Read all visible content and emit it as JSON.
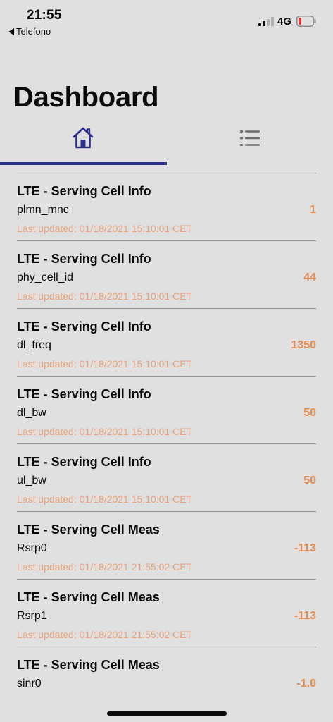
{
  "status_bar": {
    "time": "21:55",
    "back_label": "Telefono",
    "network": "4G",
    "signal_icon": "cellular-signal-icon",
    "battery_icon": "battery-low-icon"
  },
  "header": {
    "title": "Dashboard"
  },
  "tabs": {
    "home_icon": "home-icon",
    "list_icon": "list-icon",
    "selected": "home",
    "accent_color": "#2b2f8c"
  },
  "colors": {
    "value": "#e68a4d",
    "updated": "#e9a27a"
  },
  "items": [
    {
      "title": "LTE - Serving Cell Info",
      "key": "plmn_mnc",
      "value": "1",
      "updated": "Last updated: 01/18/2021 15:10:01 CET"
    },
    {
      "title": "LTE - Serving Cell Info",
      "key": "phy_cell_id",
      "value": "44",
      "updated": "Last updated: 01/18/2021 15:10:01 CET"
    },
    {
      "title": "LTE - Serving Cell Info",
      "key": "dl_freq",
      "value": "1350",
      "updated": "Last updated: 01/18/2021 15:10:01 CET"
    },
    {
      "title": "LTE - Serving Cell Info",
      "key": "dl_bw",
      "value": "50",
      "updated": "Last updated: 01/18/2021 15:10:01 CET"
    },
    {
      "title": "LTE - Serving Cell Info",
      "key": "ul_bw",
      "value": "50",
      "updated": "Last updated: 01/18/2021 15:10:01 CET"
    },
    {
      "title": "LTE - Serving Cell Meas",
      "key": "Rsrp0",
      "value": "-113",
      "updated": "Last updated: 01/18/2021 21:55:02 CET"
    },
    {
      "title": "LTE - Serving Cell Meas",
      "key": "Rsrp1",
      "value": "-113",
      "updated": "Last updated: 01/18/2021 21:55:02 CET"
    },
    {
      "title": "LTE - Serving Cell Meas",
      "key": "sinr0",
      "value": "-1.0",
      "updated": ""
    }
  ]
}
